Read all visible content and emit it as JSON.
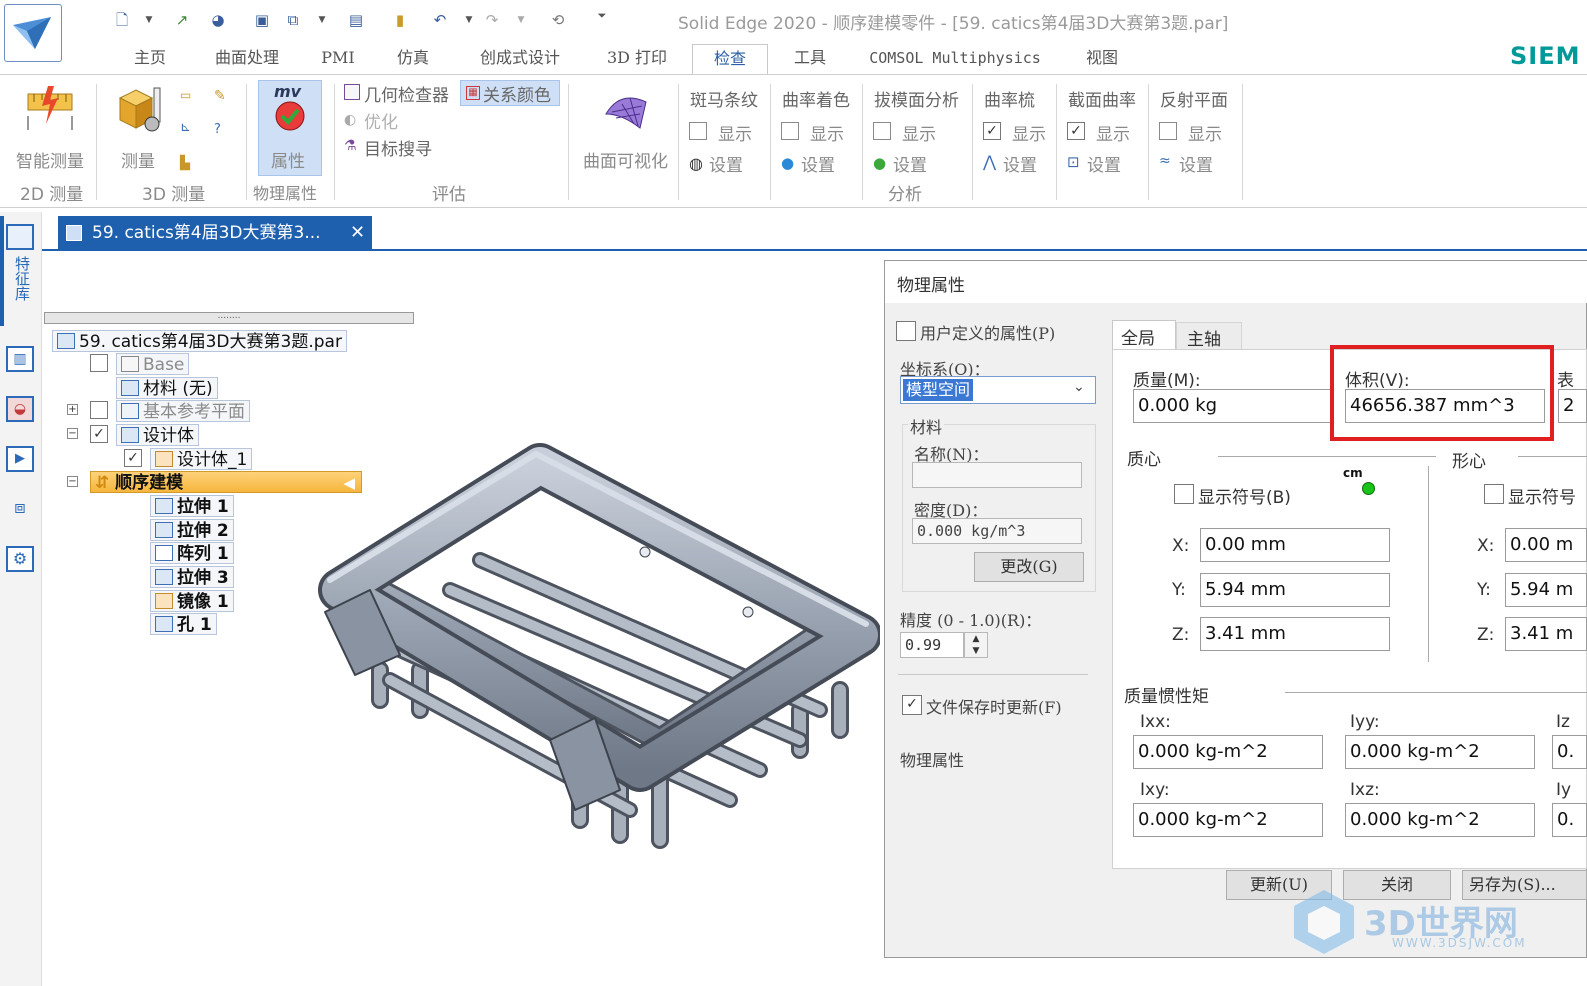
{
  "window": {
    "title": "Solid Edge 2020 - 顺序建模零件 - [59. catics第4届3D大赛第3题.par]",
    "brand": "SIEM"
  },
  "tabs": [
    "主页",
    "曲面处理",
    "PMI",
    "仿真",
    "创成式设计",
    "3D 打印",
    "检查",
    "工具",
    "COMSOL Multiphysics",
    "视图"
  ],
  "ribbon": {
    "smart_measure": "智能测量",
    "measure": "测量",
    "properties": "属性",
    "properties_icon_text": "mv",
    "geom_inspector": "几何检查器",
    "relation_color": "关系颜色",
    "optimize": "优化",
    "goal_seek": "目标搜寻",
    "surface_vis": "曲面可视化",
    "zebra": "斑马条纹",
    "curv_shading": "曲率着色",
    "draft_analysis": "拔模面分析",
    "curv_comb": "曲率梳",
    "section_curv": "截面曲率",
    "reflect_plane": "反射平面",
    "show": "显示",
    "settings": "设置",
    "groups": {
      "m2d": "2D 测量",
      "m3d": "3D 测量",
      "phys": "物理属性",
      "eval": "评估",
      "analysis": "分析"
    }
  },
  "left_strip": {
    "label": "特征库"
  },
  "doc_tab": {
    "title": "59. catics第4届3D大赛第3...",
    "close": "✕"
  },
  "tree": {
    "grip": "........",
    "root": "59. catics第4届3D大赛第3题.par",
    "base": "Base",
    "material": "材料 (无)",
    "ref_planes": "基本参考平面",
    "design_bodies": "设计体",
    "design_body_1": "设计体_1",
    "ordered": "顺序建模",
    "features": [
      "拉伸 1",
      "拉伸 2",
      "阵列 1",
      "拉伸 3",
      "镜像 1",
      "孔 1"
    ]
  },
  "dialog": {
    "title": "物理属性",
    "user_defined": "用户定义的属性(P)",
    "coord_label": "坐标系(O)：",
    "coord_value": "模型空间",
    "material_group": "材料",
    "name_label": "名称(N)：",
    "name_value": "",
    "density_label": "密度(D)：",
    "density_value": "0.000 kg/m^3",
    "change_btn": "更改(G)",
    "precision_label": "精度 (0 - 1.0)(R)：",
    "precision_value": "0.99",
    "update_on_save": "文件保存时更新(F)",
    "footer_label": "物理属性",
    "tab_global": "全局",
    "tab_axes": "主轴",
    "mass_label": "质量(M):",
    "mass_value": "0.000 kg",
    "volume_label": "体积(V):",
    "volume_value": "46656.387 mm^3",
    "surface_label_cut": "表",
    "surface_value_cut": "2",
    "centroid_label": "质心",
    "form_center_label": "形心",
    "show_symbol": "显示符号(B)",
    "show_symbol_cut": "显示符号",
    "cm_label": "cm",
    "x_label": "X:",
    "y_label": "Y:",
    "z_label": "Z:",
    "cx": "0.00 mm",
    "cy": "5.94 mm",
    "cz": "3.41 mm",
    "fx": "0.00 m",
    "fy": "5.94 m",
    "fz": "3.41 m",
    "inertia_label": "质量惯性矩",
    "ixx_label": "Ixx:",
    "iyy_label": "Iyy:",
    "izz_label_cut": "Iz",
    "ixy_label": "Ixy:",
    "ixz_label": "Ixz:",
    "iyz_label_cut": "Iy",
    "ixx": "0.000 kg-m^2",
    "iyy": "0.000 kg-m^2",
    "ixy": "0.000 kg-m^2",
    "ixz": "0.000 kg-m^2",
    "cut_val": "0.",
    "update_btn": "更新(U)",
    "close_btn": "关闭",
    "saveas_btn": "另存为(S)..."
  },
  "watermark": {
    "brand": "3D世界网",
    "url": "WWW.3DSJW.COM"
  },
  "colors": {
    "accent": "#1e5fae",
    "highlight": "#e02020",
    "selection": "#3a78d4",
    "ordered_bar": "#f5b63c"
  }
}
